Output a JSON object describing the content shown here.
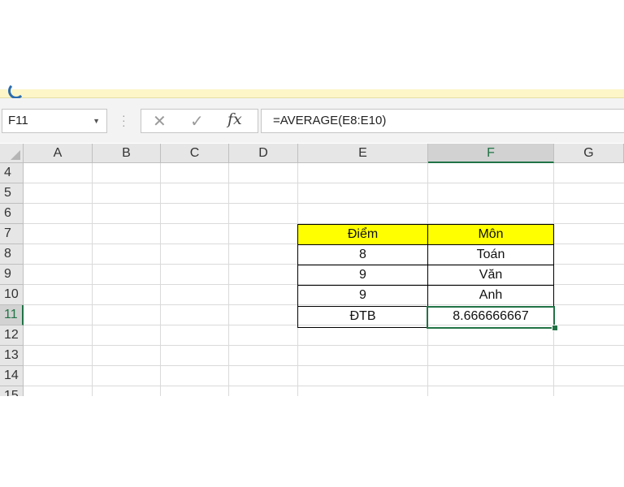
{
  "name_box": {
    "value": "F11",
    "dropdown_icon": "chevron-down-icon"
  },
  "formula_bar": {
    "cancel_icon": "✕",
    "enter_icon": "✓",
    "fx_label": "fx",
    "formula": "=AVERAGE(E8:E10)"
  },
  "columns": [
    "A",
    "B",
    "C",
    "D",
    "E",
    "F",
    "G"
  ],
  "rows": [
    "4",
    "5",
    "6",
    "7",
    "8",
    "9",
    "10",
    "11",
    "12",
    "13",
    "14",
    "15"
  ],
  "selected": {
    "column": "F",
    "row": "11"
  },
  "table": {
    "header": {
      "E": "Điểm",
      "F": "Môn"
    },
    "body": [
      {
        "E": "8",
        "F": "Toán"
      },
      {
        "E": "9",
        "F": "Văn"
      },
      {
        "E": "9",
        "F": "Anh"
      },
      {
        "E": "ĐTB",
        "F": "8.666666667"
      }
    ],
    "header_fill": "#ffff00"
  },
  "colors": {
    "accent": "#217346",
    "banner": "#fcf6c9"
  }
}
